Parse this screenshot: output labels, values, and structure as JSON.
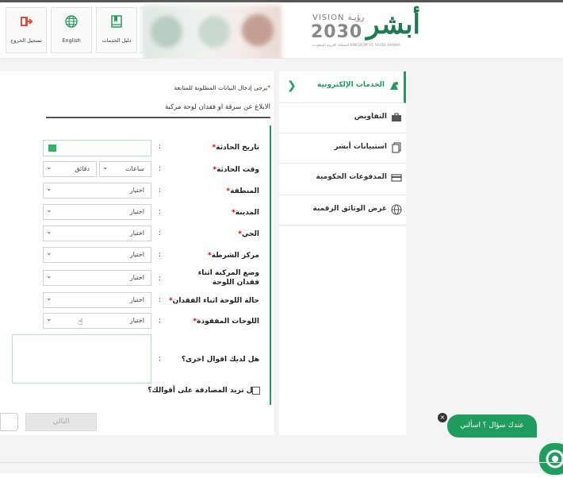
{
  "header": {
    "tiles": [
      {
        "label": "تسجيل الخروج",
        "icon": "logout-icon"
      },
      {
        "label": "English",
        "icon": "globe-icon"
      },
      {
        "label": "دليل الخدمات",
        "icon": "book-icon"
      }
    ],
    "logo": {
      "vision": "VISION رؤيـة",
      "year": "2030",
      "kingdom": "المملكة العربية السعودية KINGDOM OF SAUDI ARABIA",
      "brand": "أبشر"
    }
  },
  "sidebar": {
    "items": [
      {
        "label": "الخدمات الإلكترونية",
        "icon": "services-icon",
        "active": true
      },
      {
        "label": "التفاويض",
        "icon": "briefcase-icon",
        "active": false
      },
      {
        "label": "استبيانات أبشر",
        "icon": "survey-icon",
        "active": false
      },
      {
        "label": "المدفوعات الحكومية",
        "icon": "card-icon",
        "active": false
      },
      {
        "label": "عرض الوثائق الرقمية",
        "icon": "globe-icon",
        "active": false
      }
    ]
  },
  "main": {
    "required_note": "يرجى إدخال البيانات المطلوبة للمتابعة",
    "required_mark": "*",
    "section_title": "الابلاغ عن سرقة او فقدان لوحة مركبة",
    "colon": ":",
    "fields": {
      "accident_date": {
        "label": "تاريخ الحادثة"
      },
      "accident_time": {
        "label": "وقت الحادثة",
        "hours": "ساعات",
        "minutes": "دقائق"
      },
      "region": {
        "label": "المنطقة",
        "value": "اختيار"
      },
      "city": {
        "label": "المدينة",
        "value": "اختيار"
      },
      "district": {
        "label": "الحي",
        "value": "اختيار"
      },
      "police_center": {
        "label": "مركز الشرطة",
        "value": "اختيار"
      },
      "vehicle_status": {
        "label": "وضع المركبة اثناء فقدان اللوحة",
        "value": "اختيار"
      },
      "plate_status": {
        "label": "حالة اللوحة اثناء الفقدان",
        "value": "اختيار"
      },
      "lost_plates": {
        "label": "اللوحات المفقودة",
        "value": "اختيار"
      },
      "other_statements": {
        "label": "هل لديك اقوال اخرى؟"
      }
    },
    "confirm_label": "هل تريد المصادقة على أقوالك؟",
    "next_button": "التالي"
  },
  "chat": {
    "bubble": "عندك سؤال ؟ اسألني",
    "close": "×"
  }
}
